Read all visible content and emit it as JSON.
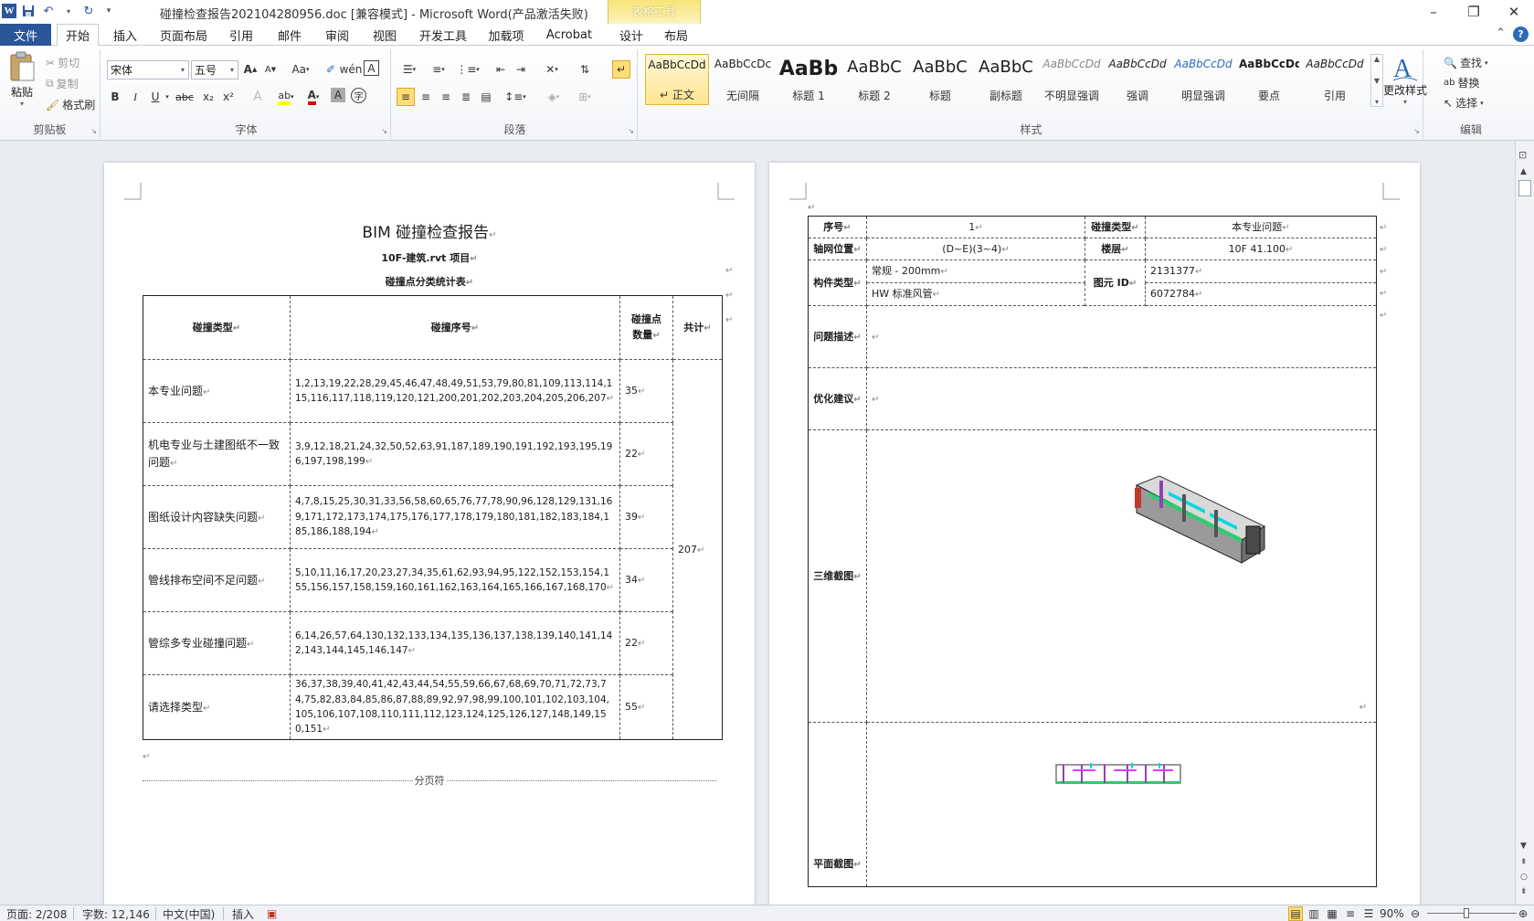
{
  "titlebar": {
    "document_title": "碰撞检查报告202104280956.doc [兼容模式]  -  Microsoft Word(产品激活失败)",
    "contextual_tools": "表格工具",
    "qat_icons": [
      "word-logo-icon",
      "save-icon",
      "undo-icon",
      "redo-icon",
      "customize-qat-icon"
    ]
  },
  "tabs": {
    "file": "文件",
    "items": [
      "开始",
      "插入",
      "页面布局",
      "引用",
      "邮件",
      "审阅",
      "视图",
      "开发工具",
      "加载项",
      "Acrobat",
      "设计",
      "布局"
    ],
    "active": "开始"
  },
  "ribbon": {
    "clipboard": {
      "label": "剪贴板",
      "paste": "粘贴",
      "cut": "剪切",
      "copy": "复制",
      "format_painter": "格式刷"
    },
    "font": {
      "label": "字体",
      "font_name": "宋体",
      "font_size": "五号",
      "grow": "A",
      "shrink": "A",
      "case": "Aa",
      "bold": "B",
      "italic": "I",
      "underline": "U",
      "strike": "abc",
      "sub": "x₂",
      "sup": "x²",
      "effects": "A",
      "highlight": "ab",
      "color": "A",
      "shade": "A",
      "enclose": "字"
    },
    "paragraph": {
      "label": "段落"
    },
    "styles": {
      "label": "样式",
      "items": [
        {
          "sample": "AaBbCcDd",
          "name": "↵ 正文"
        },
        {
          "sample": "AaBbCcDc",
          "name": "无间隔"
        },
        {
          "sample": "AaBb",
          "name": "标题 1"
        },
        {
          "sample": "AaBbC",
          "name": "标题 2"
        },
        {
          "sample": "AaBbC",
          "name": "标题"
        },
        {
          "sample": "AaBbC",
          "name": "副标题"
        },
        {
          "sample": "AaBbCcDd",
          "name": "不明显强调"
        },
        {
          "sample": "AaBbCcDd",
          "name": "强调"
        },
        {
          "sample": "AaBbCcDd",
          "name": "明显强调"
        },
        {
          "sample": "AaBbCcDd",
          "name": "要点"
        },
        {
          "sample": "AaBbCcDd",
          "name": "引用"
        }
      ],
      "change_styles": "更改样式"
    },
    "editing": {
      "label": "编辑",
      "find": "查找",
      "replace": "替换",
      "select": "选择"
    }
  },
  "page1": {
    "title": "BIM 碰撞检查报告",
    "subtitle": "10F-建筑.rvt 项目",
    "table_title": "碰撞点分类统计表",
    "headers": [
      "碰撞类型",
      "碰撞序号",
      "碰撞点\n数量",
      "共计"
    ],
    "rows": [
      {
        "type": "本专业问题",
        "ids": "1,2,13,19,22,28,29,45,46,47,48,49,51,53,79,80,81,109,113,114,115,116,117,118,119,120,121,200,201,202,203,204,205,206,207",
        "count": "35"
      },
      {
        "type": "机电专业与土建图纸不一致问题",
        "ids": "3,9,12,18,21,24,32,50,52,63,91,187,189,190,191,192,193,195,196,197,198,199",
        "count": "22"
      },
      {
        "type": "图纸设计内容缺失问题",
        "ids": "4,7,8,15,25,30,31,33,56,58,60,65,76,77,78,90,96,128,129,131,169,171,172,173,174,175,176,177,178,179,180,181,182,183,184,185,186,188,194",
        "count": "39"
      },
      {
        "type": "管线排布空间不足问题",
        "ids": "5,10,11,16,17,20,23,27,34,35,61,62,93,94,95,122,152,153,154,155,156,157,158,159,160,161,162,163,164,165,166,167,168,170",
        "count": "34"
      },
      {
        "type": "管综多专业碰撞问题",
        "ids": "6,14,26,57,64,130,132,133,134,135,136,137,138,139,140,141,142,143,144,145,146,147",
        "count": "22"
      },
      {
        "type": "请选择类型",
        "ids": "36,37,38,39,40,41,42,43,44,54,55,59,66,67,68,69,70,71,72,73,74,75,82,83,84,85,86,87,88,89,92,97,98,99,100,101,102,103,104,105,106,107,108,110,111,112,123,124,125,126,127,148,149,150,151",
        "count": "55"
      }
    ],
    "total": "207",
    "page_break": "分页符"
  },
  "page2": {
    "seq_label": "序号",
    "seq_value": "1",
    "type_label": "碰撞类型",
    "type_value": "本专业问题",
    "grid_label": "轴网位置",
    "grid_value": "(D~E)(3~4)",
    "floor_label": "楼层",
    "floor_value": "10F 41.100",
    "comp_label": "构件类型",
    "comp_value_1": "常规 - 200mm",
    "comp_value_2": "HW 标准风管",
    "id_label": "图元 ID",
    "id_value_1": "2131377",
    "id_value_2": "6072784",
    "problem_label": "问题描述",
    "suggest_label": "优化建议",
    "view3d_label": "三维截图",
    "plan_label": "平面截图"
  },
  "statusbar": {
    "page": "页面: 2/208",
    "words": "字数: 12,146",
    "language": "中文(中国)",
    "mode": "插入",
    "zoom": "90%"
  },
  "colors": {
    "accent": "#2b579a",
    "file_tab": "#2a5699",
    "table_tools": "#f7e579"
  }
}
